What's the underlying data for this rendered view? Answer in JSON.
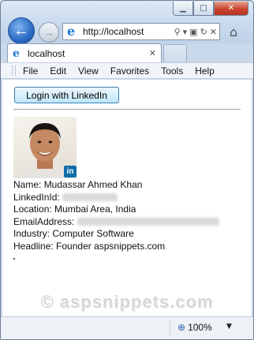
{
  "browser": {
    "address": "http://localhost",
    "tab_title": "localhost",
    "menu": [
      "File",
      "Edit",
      "View",
      "Favorites",
      "Tools",
      "Help"
    ],
    "zoom": "100%"
  },
  "page": {
    "login_button": "Login with LinkedIn",
    "linkedin_badge": "in",
    "fields": {
      "name_label": "Name:",
      "name_value": "Mudassar Ahmed Khan",
      "linkedinid_label": "LinkedInId:",
      "location_label": "Location:",
      "location_value": "Mumbai Area, India",
      "email_label": "EmailAddress:",
      "industry_label": "Industry:",
      "industry_value": "Computer Software",
      "headline_label": "Headline:",
      "headline_value": "Founder aspsnippets.com"
    },
    "watermark": "© aspsnippets.com"
  },
  "icons": {
    "back": "back-arrow-icon",
    "forward": "forward-arrow-icon",
    "home": "home-icon",
    "ie": "ie-logo-icon"
  }
}
